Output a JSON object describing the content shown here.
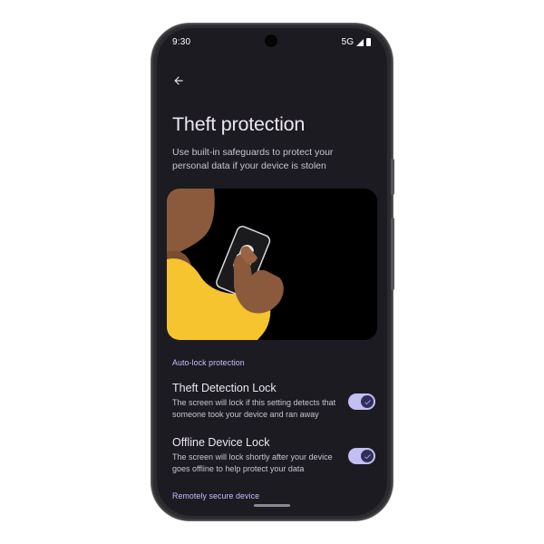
{
  "status_bar": {
    "time": "9:30",
    "network": "5G",
    "signal_icon": "signal-icon",
    "battery_icon": "battery-icon"
  },
  "header": {
    "back_icon": "arrow-back-icon",
    "title": "Theft protection",
    "description": "Use built-in safeguards to protect your personal data if your device is stolen"
  },
  "illustration": {
    "icon": "unlocked-padlock-icon"
  },
  "sections": {
    "auto_lock": {
      "header": "Auto-lock protection",
      "items": [
        {
          "title": "Theft Detection Lock",
          "description": "The screen will lock if this setting detects that someone took your device and ran away",
          "enabled": true
        },
        {
          "title": "Offline Device Lock",
          "description": "The screen will lock shortly after your device goes offline to help protect your data",
          "enabled": true
        }
      ]
    },
    "remote": {
      "header": "Remotely secure device"
    }
  },
  "colors": {
    "background": "#1c1b21",
    "accent": "#c8bfff",
    "toggle_track": "#c3bff3",
    "toggle_knob": "#312f5a",
    "skin": "#8b5a3c",
    "sleeve": "#f5c42e"
  }
}
